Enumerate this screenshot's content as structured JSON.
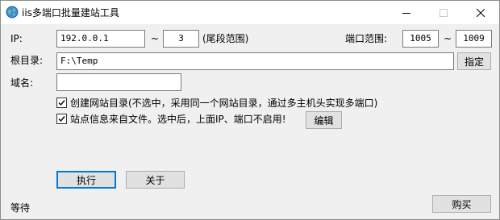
{
  "window": {
    "title": "iis多端口批量建站工具"
  },
  "ip": {
    "label": "IP:",
    "start_value": "192.0.0.1",
    "tilde": "~",
    "end_value": "3",
    "suffix": "(尾段范围)"
  },
  "port": {
    "label": "端口范围:",
    "start_value": "1005",
    "tilde": "~",
    "end_value": "1009"
  },
  "root": {
    "label": "根目录:",
    "value": "F:\\Temp",
    "button_label": "指定"
  },
  "domain": {
    "label": "域名:",
    "value": ""
  },
  "options": {
    "create_dir": {
      "checked": true,
      "label": "创建网站目录(不选中，采用同一个网站目录，通过多主机头实现多端口)"
    },
    "site_from_file": {
      "checked": true,
      "label": "站点信息来自文件。选中后，上面IP、端口不启用!"
    },
    "edit_button_label": "编辑"
  },
  "actions": {
    "run_label": "执行",
    "about_label": "关于",
    "buy_label": "购买"
  },
  "status": {
    "text": "等待"
  }
}
